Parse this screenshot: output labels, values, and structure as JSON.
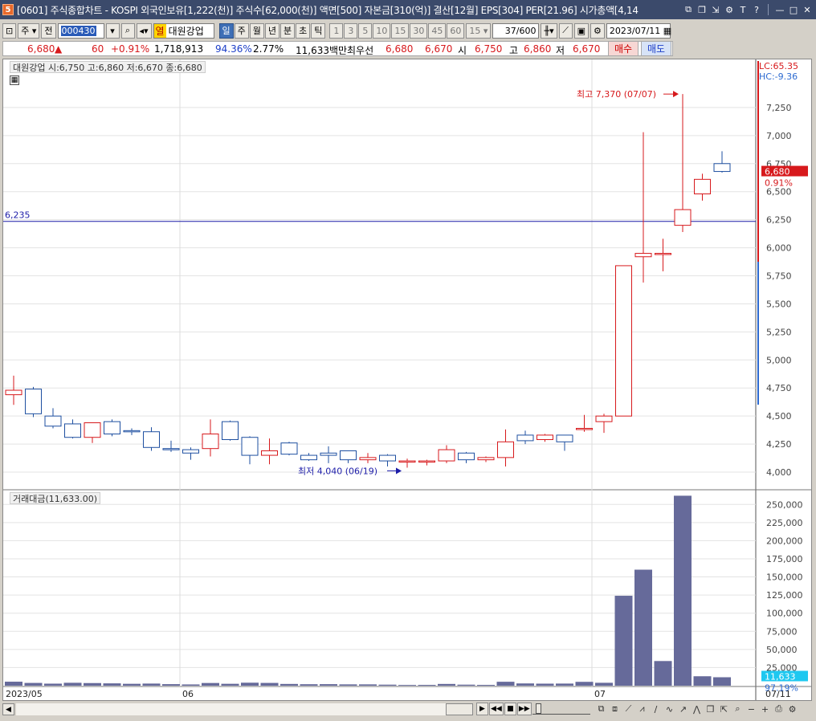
{
  "window": {
    "badge": "5",
    "title": "[0601] 주식종합차트 - KOSPI 외국인보유[1,222(천)] 주식수[62,000(천)] 액면[500] 자본금[310(억)] 결산[12월] EPS[304] PER[21.96] 시가총액[4,14"
  },
  "toolbar": {
    "period_select": "주",
    "prev_label": "전",
    "code": "000430",
    "stock_tag": "열",
    "stock_name": "대원강업",
    "periods": [
      "일",
      "주",
      "월",
      "년",
      "분",
      "초",
      "틱"
    ],
    "active_period": "일",
    "intervals": [
      "1",
      "3",
      "5",
      "10",
      "15",
      "30",
      "45",
      "60"
    ],
    "interval_value": "15",
    "count": "37",
    "count_max": "/600",
    "date": "2023/07/11"
  },
  "quote": {
    "price": "6,680",
    "change_arrow": "▲",
    "change": "60",
    "change_pct": "+0.91%",
    "volume": "1,718,913",
    "vol_ratio": "94.36%",
    "turnover": "2.77%",
    "amount": "11,633백만",
    "priority_label": "최우선",
    "ask": "6,680",
    "bid": "6,670",
    "open_label": "시",
    "open": "6,750",
    "high_label": "고",
    "high": "6,860",
    "low_label": "저",
    "low": "6,670",
    "buy_label": "매수",
    "sell_label": "매도"
  },
  "price_panel": {
    "legend": "대원강업 시:6,750 고:6,860 저:6,670 종:6,680",
    "lc": "LC:65.35",
    "hc": "HC:-9.36",
    "hline_label": "6,235",
    "current_price": "6,680",
    "current_pct": "0.91%",
    "max_annotation": "최고 7,370 (07/07)",
    "min_annotation": "최저 4,040 (06/19)"
  },
  "volume_panel": {
    "legend": "거래대금(11,633.00)",
    "current": "11,633",
    "pct": "97.19%"
  },
  "x_labels": [
    "2023/05",
    "06",
    "07"
  ],
  "x_end_label": "07/11",
  "colors": {
    "up": "#d7191c",
    "down": "#1e4fa0",
    "volume": "#666a9a",
    "hline": "#1c1ca8"
  },
  "chart_data": [
    {
      "type": "candlestick",
      "title": "대원강업",
      "ylim": [
        3900,
        7550
      ],
      "yticks": [
        4000,
        4250,
        4500,
        4750,
        5000,
        5250,
        5500,
        5750,
        6000,
        6250,
        6500,
        6750,
        7000,
        7250
      ],
      "reference_line": 6235,
      "candles": [
        {
          "o": 4690,
          "h": 4860,
          "l": 4600,
          "c": 4730
        },
        {
          "o": 4740,
          "h": 4760,
          "l": 4490,
          "c": 4520
        },
        {
          "o": 4500,
          "h": 4570,
          "l": 4390,
          "c": 4410
        },
        {
          "o": 4430,
          "h": 4470,
          "l": 4300,
          "c": 4310
        },
        {
          "o": 4310,
          "h": 4440,
          "l": 4260,
          "c": 4440
        },
        {
          "o": 4450,
          "h": 4470,
          "l": 4320,
          "c": 4340
        },
        {
          "o": 4370,
          "h": 4390,
          "l": 4330,
          "c": 4360
        },
        {
          "o": 4360,
          "h": 4400,
          "l": 4190,
          "c": 4220
        },
        {
          "o": 4210,
          "h": 4280,
          "l": 4180,
          "c": 4200
        },
        {
          "o": 4200,
          "h": 4220,
          "l": 4110,
          "c": 4170
        },
        {
          "o": 4210,
          "h": 4470,
          "l": 4140,
          "c": 4340
        },
        {
          "o": 4450,
          "h": 4460,
          "l": 4280,
          "c": 4290
        },
        {
          "o": 4310,
          "h": 4320,
          "l": 4070,
          "c": 4150
        },
        {
          "o": 4150,
          "h": 4300,
          "l": 4070,
          "c": 4190
        },
        {
          "o": 4260,
          "h": 4270,
          "l": 4150,
          "c": 4160
        },
        {
          "o": 4150,
          "h": 4170,
          "l": 4100,
          "c": 4110
        },
        {
          "o": 4170,
          "h": 4230,
          "l": 4080,
          "c": 4150
        },
        {
          "o": 4190,
          "h": 4190,
          "l": 4080,
          "c": 4110
        },
        {
          "o": 4110,
          "h": 4170,
          "l": 4080,
          "c": 4130
        },
        {
          "o": 4150,
          "h": 4160,
          "l": 4050,
          "c": 4100
        },
        {
          "o": 4090,
          "h": 4120,
          "l": 4040,
          "c": 4100
        },
        {
          "o": 4090,
          "h": 4110,
          "l": 4060,
          "c": 4100
        },
        {
          "o": 4100,
          "h": 4240,
          "l": 4080,
          "c": 4200
        },
        {
          "o": 4170,
          "h": 4180,
          "l": 4080,
          "c": 4110
        },
        {
          "o": 4110,
          "h": 4140,
          "l": 4090,
          "c": 4130
        },
        {
          "o": 4130,
          "h": 4380,
          "l": 4050,
          "c": 4270
        },
        {
          "o": 4330,
          "h": 4370,
          "l": 4250,
          "c": 4280
        },
        {
          "o": 4290,
          "h": 4340,
          "l": 4270,
          "c": 4330
        },
        {
          "o": 4330,
          "h": 4330,
          "l": 4190,
          "c": 4270
        },
        {
          "o": 4390,
          "h": 4510,
          "l": 4360,
          "c": 4390
        },
        {
          "o": 4450,
          "h": 4520,
          "l": 4350,
          "c": 4500
        },
        {
          "o": 4500,
          "h": 5840,
          "l": 4500,
          "c": 5840
        },
        {
          "o": 5920,
          "h": 7030,
          "l": 5690,
          "c": 5950
        },
        {
          "o": 5950,
          "h": 6080,
          "l": 5790,
          "c": 5950
        },
        {
          "o": 6200,
          "h": 7370,
          "l": 6140,
          "c": 6340
        },
        {
          "o": 6480,
          "h": 6660,
          "l": 6420,
          "c": 6610
        },
        {
          "o": 6750,
          "h": 6860,
          "l": 6670,
          "c": 6680
        }
      ]
    },
    {
      "type": "bar",
      "title": "거래대금",
      "ylim": [
        0,
        268000
      ],
      "yticks": [
        25000,
        50000,
        75000,
        100000,
        125000,
        150000,
        175000,
        200000,
        225000,
        250000
      ],
      "values": [
        5500,
        3800,
        2800,
        4000,
        3600,
        3200,
        2600,
        2900,
        2100,
        1700,
        3700,
        2600,
        4100,
        3800,
        2400,
        2000,
        2100,
        1800,
        1800,
        1400,
        1000,
        1100,
        2400,
        1400,
        1100,
        5400,
        3100,
        2800,
        2900,
        5300,
        4000,
        124000,
        160000,
        34000,
        262000,
        13000,
        11633
      ]
    }
  ]
}
